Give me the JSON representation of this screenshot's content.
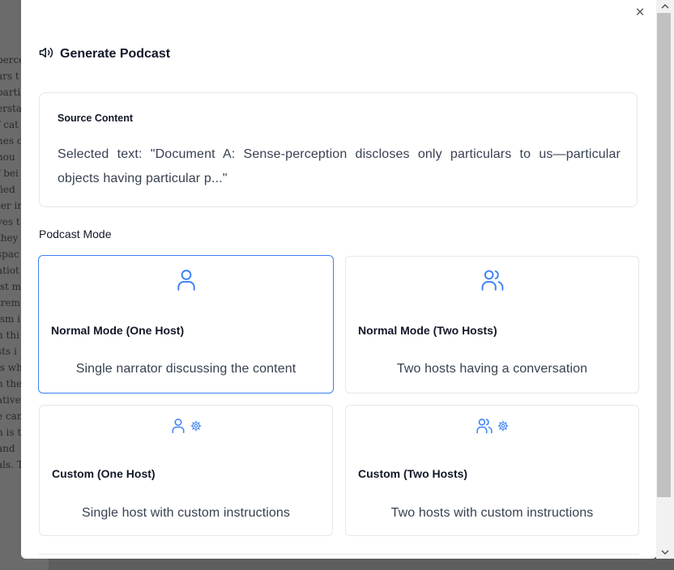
{
  "background_doc": {
    "lines": [
      "perce",
      "ars t",
      "partic",
      "ersta",
      "f cat",
      "nes c",
      "hou",
      "f bei",
      "fied",
      "ter in",
      "ves t",
      "they",
      "spac",
      "atiot",
      "ist m",
      "trem",
      "ism i",
      "h thi",
      "sts i",
      "is wh",
      "n the",
      "ative",
      "e can",
      "n is t",
      "and",
      "als. T"
    ]
  },
  "modal": {
    "close_label": "×",
    "title": "Generate Podcast",
    "source": {
      "label": "Source Content",
      "text": "Selected text: \"Document A: Sense-perception discloses only particulars to us—particular objects having particular p...\""
    },
    "mode_label": "Podcast Mode",
    "modes": [
      {
        "title": "Normal Mode (One Host)",
        "desc": "Single narrator discussing the content",
        "icon": "user-icon",
        "selected": true
      },
      {
        "title": "Normal Mode (Two Hosts)",
        "desc": "Two hosts having a conversation",
        "icon": "users-icon",
        "selected": false
      },
      {
        "title": "Custom (One Host)",
        "desc": "Single host with custom instructions",
        "icon": "user-gear-icon",
        "selected": false
      },
      {
        "title": "Custom (Two Hosts)",
        "desc": "Two hosts with custom instructions",
        "icon": "users-gear-icon",
        "selected": false
      }
    ]
  },
  "colors": {
    "accent": "#3b82f6",
    "border": "#e5e7eb",
    "text": "#111827"
  }
}
